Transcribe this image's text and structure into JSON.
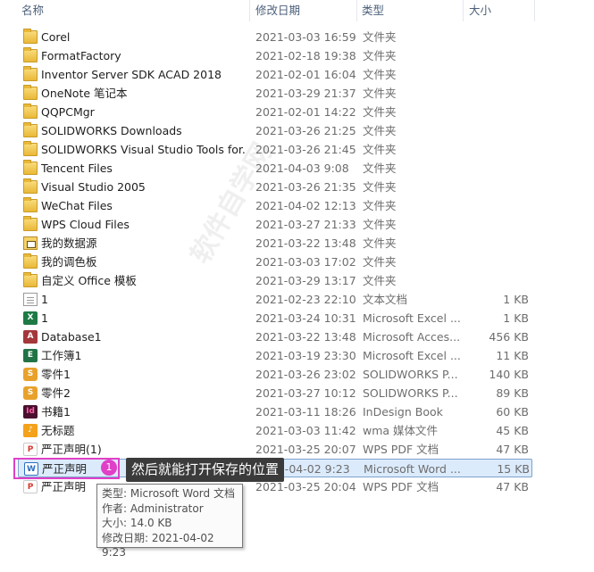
{
  "columns": {
    "name": "名称",
    "date": "修改日期",
    "type": "类型",
    "size": "大小"
  },
  "files": [
    {
      "name": "Corel",
      "date": "2021-03-03 16:59",
      "type": "文件夹",
      "size": "",
      "icon": "folder-icon"
    },
    {
      "name": "FormatFactory",
      "date": "2021-02-18 19:38",
      "type": "文件夹",
      "size": "",
      "icon": "folder-icon"
    },
    {
      "name": "Inventor Server SDK ACAD 2018",
      "date": "2021-02-01 16:04",
      "type": "文件夹",
      "size": "",
      "icon": "folder-icon"
    },
    {
      "name": "OneNote 笔记本",
      "date": "2021-03-29 21:37",
      "type": "文件夹",
      "size": "",
      "icon": "folder-icon"
    },
    {
      "name": "QQPCMgr",
      "date": "2021-02-01 14:22",
      "type": "文件夹",
      "size": "",
      "icon": "folder-icon"
    },
    {
      "name": "SOLIDWORKS Downloads",
      "date": "2021-03-26 21:25",
      "type": "文件夹",
      "size": "",
      "icon": "folder-icon"
    },
    {
      "name": "SOLIDWORKS Visual Studio Tools for...",
      "date": "2021-03-26 21:45",
      "type": "文件夹",
      "size": "",
      "icon": "folder-icon"
    },
    {
      "name": "Tencent Files",
      "date": "2021-04-03 9:08",
      "type": "文件夹",
      "size": "",
      "icon": "folder-icon"
    },
    {
      "name": "Visual Studio 2005",
      "date": "2021-03-26 21:35",
      "type": "文件夹",
      "size": "",
      "icon": "folder-icon"
    },
    {
      "name": "WeChat Files",
      "date": "2021-04-02 12:13",
      "type": "文件夹",
      "size": "",
      "icon": "folder-icon"
    },
    {
      "name": "WPS Cloud Files",
      "date": "2021-03-27 21:33",
      "type": "文件夹",
      "size": "",
      "icon": "folder-icon"
    },
    {
      "name": "我的数据源",
      "date": "2021-03-22 13:48",
      "type": "文件夹",
      "size": "",
      "icon": "data-source-folder-icon"
    },
    {
      "name": "我的调色板",
      "date": "2021-03-03 17:02",
      "type": "文件夹",
      "size": "",
      "icon": "folder-icon"
    },
    {
      "name": "自定义 Office 模板",
      "date": "2021-03-29 13:17",
      "type": "文件夹",
      "size": "",
      "icon": "folder-icon"
    },
    {
      "name": "1",
      "date": "2021-02-23 22:10",
      "type": "文本文档",
      "size": "1 KB",
      "icon": "text-file-icon"
    },
    {
      "name": "1",
      "date": "2021-03-24 10:31",
      "type": "Microsoft Excel ...",
      "size": "1 KB",
      "icon": "excel-file-icon"
    },
    {
      "name": "Database1",
      "date": "2021-03-22 13:48",
      "type": "Microsoft Acces...",
      "size": "456 KB",
      "icon": "access-file-icon"
    },
    {
      "name": "工作簿1",
      "date": "2021-03-19 23:30",
      "type": "Microsoft Excel ...",
      "size": "11 KB",
      "icon": "workbook-file-icon"
    },
    {
      "name": "零件1",
      "date": "2021-03-26 23:02",
      "type": "SOLIDWORKS P...",
      "size": "140 KB",
      "icon": "solidworks-part-icon"
    },
    {
      "name": "零件2",
      "date": "2021-03-27 10:12",
      "type": "SOLIDWORKS P...",
      "size": "89 KB",
      "icon": "solidworks-part-icon"
    },
    {
      "name": "书籍1",
      "date": "2021-03-11 18:26",
      "type": "InDesign Book",
      "size": "60 KB",
      "icon": "indesign-book-icon"
    },
    {
      "name": "无标题",
      "date": "2021-03-03 11:42",
      "type": "wma 媒体文件",
      "size": "45 KB",
      "icon": "wma-file-icon"
    },
    {
      "name": "严正声明(1)",
      "date": "2021-03-25 20:07",
      "type": "WPS PDF 文档",
      "size": "47 KB",
      "icon": "pdf-file-icon"
    },
    {
      "name": "严正声明",
      "date": "2021-04-02 9:23",
      "type": "Microsoft Word ...",
      "size": "15 KB",
      "icon": "word-file-icon",
      "selected": true
    },
    {
      "name": "严正声明",
      "date": "2021-03-25 20:04",
      "type": "WPS PDF 文档",
      "size": "47 KB",
      "icon": "pdf-file-icon"
    }
  ],
  "callout": {
    "number": "1",
    "text": "然后就能打开保存的位置"
  },
  "tooltip": {
    "line1": "类型: Microsoft Word 文档",
    "line2": "作者: Administrator",
    "line3": "大小: 14.0 KB",
    "line4": "修改日期: 2021-04-02 9:23"
  },
  "watermark": "软件自学网",
  "colors": {
    "selection_bg": "#dcebfc",
    "selection_border": "#7da2ce",
    "highlight": "#e040c8",
    "callout_bg": "#3b3b3b"
  }
}
